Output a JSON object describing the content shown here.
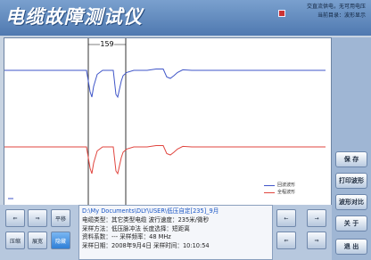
{
  "app": {
    "title": "电缆故障测试仪"
  },
  "status": {
    "line1": "交直流供电，无可用电压",
    "line2": "当前目录：波形显示"
  },
  "plot": {
    "cursor_distance": "159",
    "legend": [
      {
        "label": "回波波形",
        "color": "#3f55c8"
      },
      {
        "label": "全程波形",
        "color": "#e0453f"
      }
    ]
  },
  "chart_data": {
    "type": "line",
    "series": [
      {
        "name": "回波波形",
        "x": [
          0,
          20,
          40,
          60,
          80,
          92,
          96,
          98,
          100,
          104,
          110,
          122,
          125,
          127,
          129,
          131,
          133,
          137,
          145,
          160,
          170,
          178,
          182,
          186,
          190,
          194,
          200,
          210,
          220,
          260,
          300,
          360
        ],
        "values": [
          0,
          0,
          0,
          0,
          0,
          0,
          -0.8,
          -1,
          -0.6,
          -0.15,
          0,
          0,
          -0.9,
          -1,
          -0.7,
          -0.4,
          -0.2,
          -0.08,
          0,
          0,
          0.05,
          0.05,
          -0.25,
          -0.3,
          -0.2,
          -0.08,
          0.02,
          0,
          0,
          0,
          0,
          0
        ]
      },
      {
        "name": "全程波形",
        "x": [
          0,
          20,
          40,
          60,
          80,
          92,
          96,
          98,
          100,
          104,
          110,
          122,
          125,
          127,
          129,
          131,
          133,
          137,
          145,
          160,
          170,
          178,
          182,
          186,
          190,
          194,
          200,
          210,
          220,
          260,
          300,
          360
        ],
        "values": [
          0,
          0,
          0,
          0,
          0,
          0,
          -0.8,
          -1,
          -0.6,
          -0.15,
          0,
          0,
          -0.9,
          -1,
          -0.7,
          -0.4,
          -0.2,
          -0.08,
          0,
          0,
          0.05,
          0.05,
          -0.25,
          -0.3,
          -0.2,
          -0.08,
          0.02,
          0,
          0,
          0,
          0,
          0
        ]
      }
    ]
  },
  "info": {
    "path": "D:\\My Documents\\DLY\\USER\\低压自定[235]_9月",
    "line1": "电缆类型：其它类型电缆 波行速度：235米/微秒",
    "line2": "采样方法：低压脉冲法  长度选择：短距离",
    "line3": "资料系数：---    采样频率：48 MHz",
    "line4": "采样日期：2008年9月4日 采样时间：10:10:54"
  },
  "right_buttons": [
    "保 存",
    "打印波形",
    "波形对比",
    "关 于",
    "退 出"
  ],
  "left_buttons": [
    "压缩",
    "展宽",
    "平移",
    "拉伸",
    "隐藏",
    "双光标"
  ],
  "nav_buttons": [
    "←",
    "→",
    "⇐",
    "⇒"
  ],
  "colors": {
    "echo": "#3f55c8",
    "full": "#e0453f",
    "active": "#2f7fd7"
  }
}
